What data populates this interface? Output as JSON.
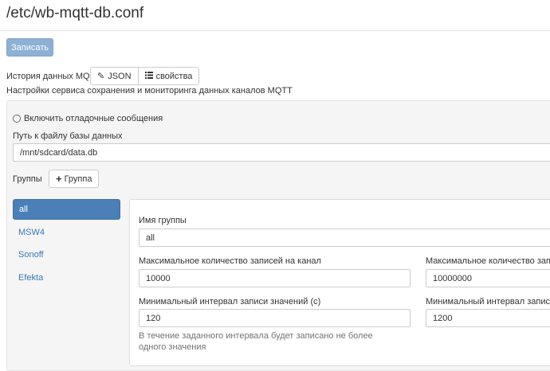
{
  "header": {
    "title": "/etc/wb-mqtt-db.conf"
  },
  "toolbar": {
    "save_label": "Записать"
  },
  "history": {
    "label": "История данных MQTT",
    "json_button": "JSON",
    "props_button": "свойства"
  },
  "subtitle": "Настройки сервиса сохранения и мониторинга данных каналов MQTT",
  "settings": {
    "debug_label": "Включить отладочные сообщения",
    "db_path_label": "Путь к файлу базы данных",
    "db_path_value": "/mnt/sdcard/data.db"
  },
  "groups": {
    "label": "Группы",
    "add_button": "Группа",
    "items": [
      {
        "label": "all",
        "active": true
      },
      {
        "label": "MSW4"
      },
      {
        "label": "Sonoff"
      },
      {
        "label": "Efekta"
      }
    ]
  },
  "group_form": {
    "name_label": "Имя группы",
    "name_value": "all",
    "max_per_channel_label": "Максимальное количество записей на канал",
    "max_per_channel_value": "10000",
    "max_total_label": "Максимальное количество записе",
    "max_total_value": "10000000",
    "min_interval_label": "Минимальный интервал записи значений (с)",
    "min_interval_value": "120",
    "min_interval_help": "В течение заданного интервала будет записано не более одного значения",
    "min_unchanged_label": "Минимальный интервал записи, е",
    "min_unchanged_value": "1200"
  }
}
